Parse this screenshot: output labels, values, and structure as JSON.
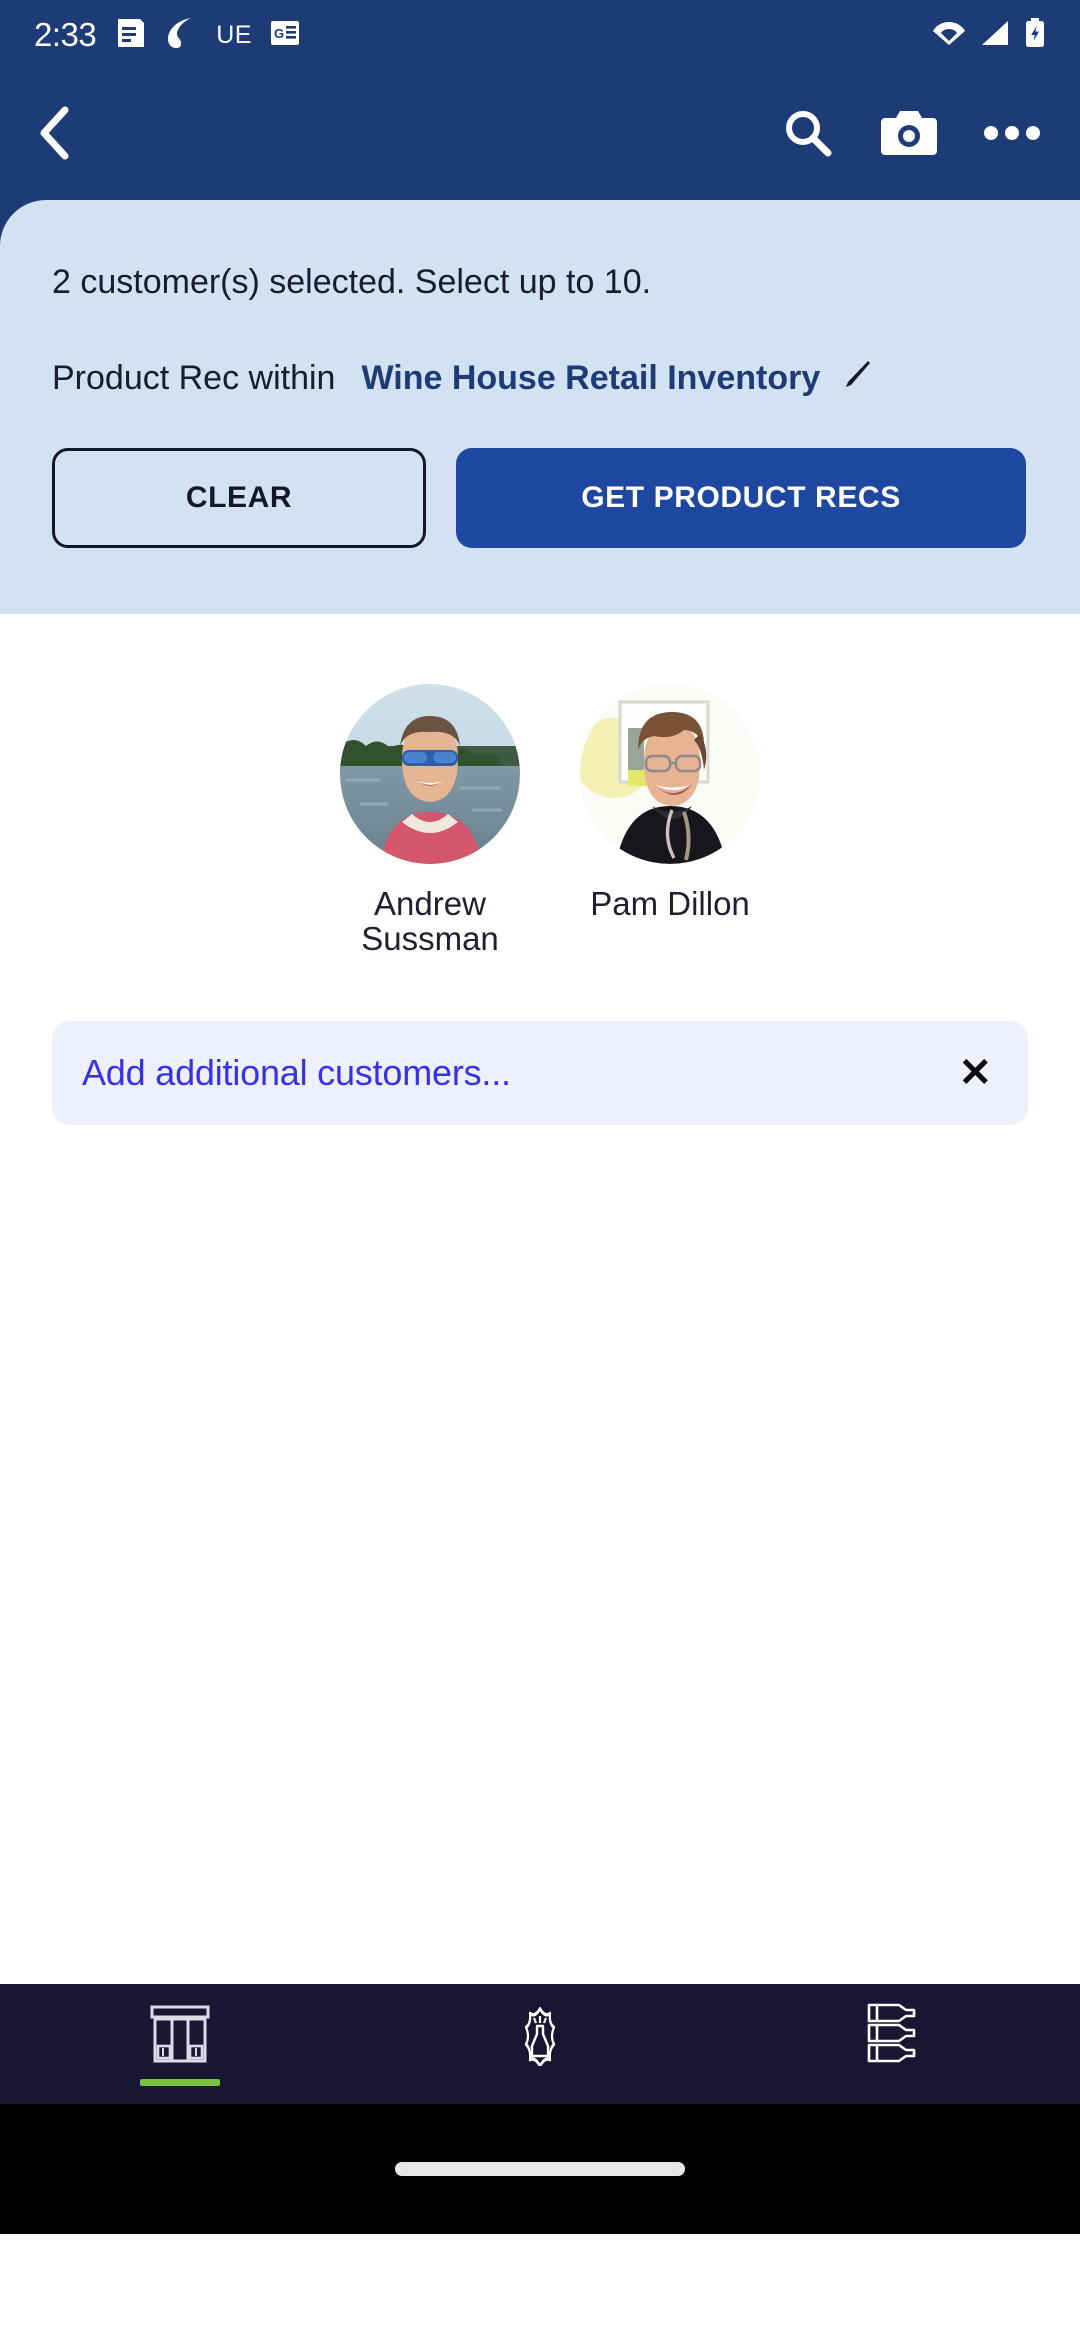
{
  "status_bar": {
    "time": "2:33",
    "left_icons": [
      "list-notification-icon",
      "swoosh-app-icon",
      "ue-label-icon",
      "google-news-icon"
    ],
    "ue_label": "UE",
    "right_icons": [
      "wifi-icon",
      "cellular-signal-icon",
      "battery-charging-icon"
    ]
  },
  "app_bar": {
    "back_icon": "back-chevron-icon",
    "actions": [
      "search-icon",
      "camera-icon",
      "overflow-menu-icon"
    ],
    "background_color": "#1d3b77"
  },
  "info_panel": {
    "background_color": "#d2e2f3",
    "selection_status": "2 customer(s) selected. Select up to 10.",
    "scope_label": "Product Rec within",
    "scope_value": "Wine House Retail Inventory",
    "scope_value_color": "#1d3b77",
    "edit_icon": "pencil-edit-icon",
    "clear_button": "CLEAR",
    "primary_button": "GET PRODUCT RECS",
    "primary_button_color": "#1e47a0"
  },
  "customers": [
    {
      "name": "Andrew Sussman",
      "avatar": "photo-man-sunglasses-lake"
    },
    {
      "name": "Pam Dillon",
      "avatar": "photo-woman-glasses-black-top"
    }
  ],
  "add_customers_field": {
    "placeholder": "Add additional customers...",
    "placeholder_color": "#3632e8",
    "background_color": "#eef1fd",
    "clear_icon": "close-x-icon",
    "clear_glyph": "✕"
  },
  "bottom_nav": {
    "background_color": "#191634",
    "active_indicator_color": "#7cc242",
    "items": [
      {
        "icon": "storefront-icon",
        "active": true
      },
      {
        "icon": "wine-bottle-badge-icon",
        "active": false
      },
      {
        "icon": "three-wine-bottles-icon",
        "active": false
      }
    ]
  }
}
